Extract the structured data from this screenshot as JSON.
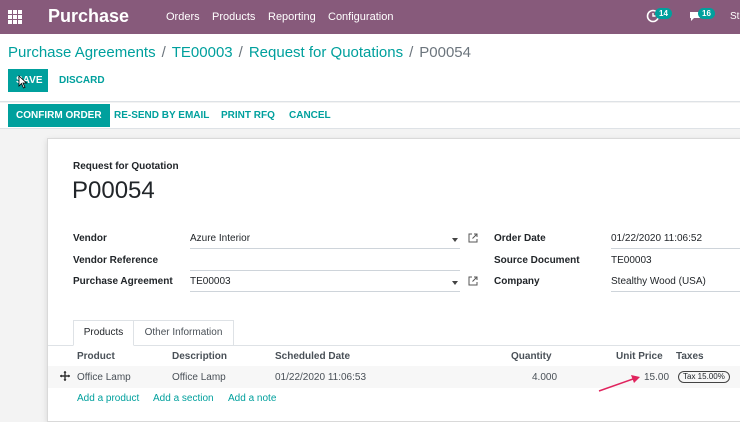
{
  "navbar": {
    "app_name": "Purchase",
    "menu": [
      "Orders",
      "Products",
      "Reporting",
      "Configuration"
    ],
    "activity_count": "14",
    "messages_count": "16",
    "user_initials": "St"
  },
  "breadcrumb": {
    "items": [
      "Purchase Agreements",
      "TE00003",
      "Request for Quotations"
    ],
    "current": "P00054"
  },
  "toolbar": {
    "save_label": "SAVE",
    "discard_label": "DISCARD"
  },
  "statusbar": {
    "confirm_label": "CONFIRM ORDER",
    "resend_label": "RE-SEND BY EMAIL",
    "print_label": "PRINT RFQ",
    "cancel_label": "CANCEL"
  },
  "form": {
    "type_label": "Request for Quotation",
    "name": "P00054",
    "vendor_label": "Vendor",
    "vendor_value": "Azure Interior",
    "vendor_ref_label": "Vendor Reference",
    "vendor_ref_value": "",
    "agreement_label": "Purchase Agreement",
    "agreement_value": "TE00003",
    "order_date_label": "Order Date",
    "order_date_value": "01/22/2020 11:06:52",
    "source_doc_label": "Source Document",
    "source_doc_value": "TE00003",
    "company_label": "Company",
    "company_value": "Stealthy Wood (USA)"
  },
  "tabs": [
    "Products",
    "Other Information"
  ],
  "lines": {
    "headers": [
      "Product",
      "Description",
      "Scheduled Date",
      "Quantity",
      "Unit Price",
      "Taxes"
    ],
    "rows": [
      {
        "product": "Office Lamp",
        "description": "Office Lamp",
        "scheduled": "01/22/2020 11:06:53",
        "quantity": "4.000",
        "unit_price": "15.00",
        "tax": "Tax 15.00%"
      }
    ],
    "add_product": "Add a product",
    "add_section": "Add a section",
    "add_note": "Add a note"
  },
  "colors": {
    "navbar": "#875a7b",
    "primary": "#00a09d",
    "annotation": "#e0245e"
  },
  "icons": [
    "apps-grid-icon",
    "activity-clock-icon",
    "chat-icon",
    "external-link-icon",
    "drag-handle-icon",
    "dropdown-caret-icon",
    "mouse-cursor-icon",
    "annotation-arrow-icon"
  ]
}
